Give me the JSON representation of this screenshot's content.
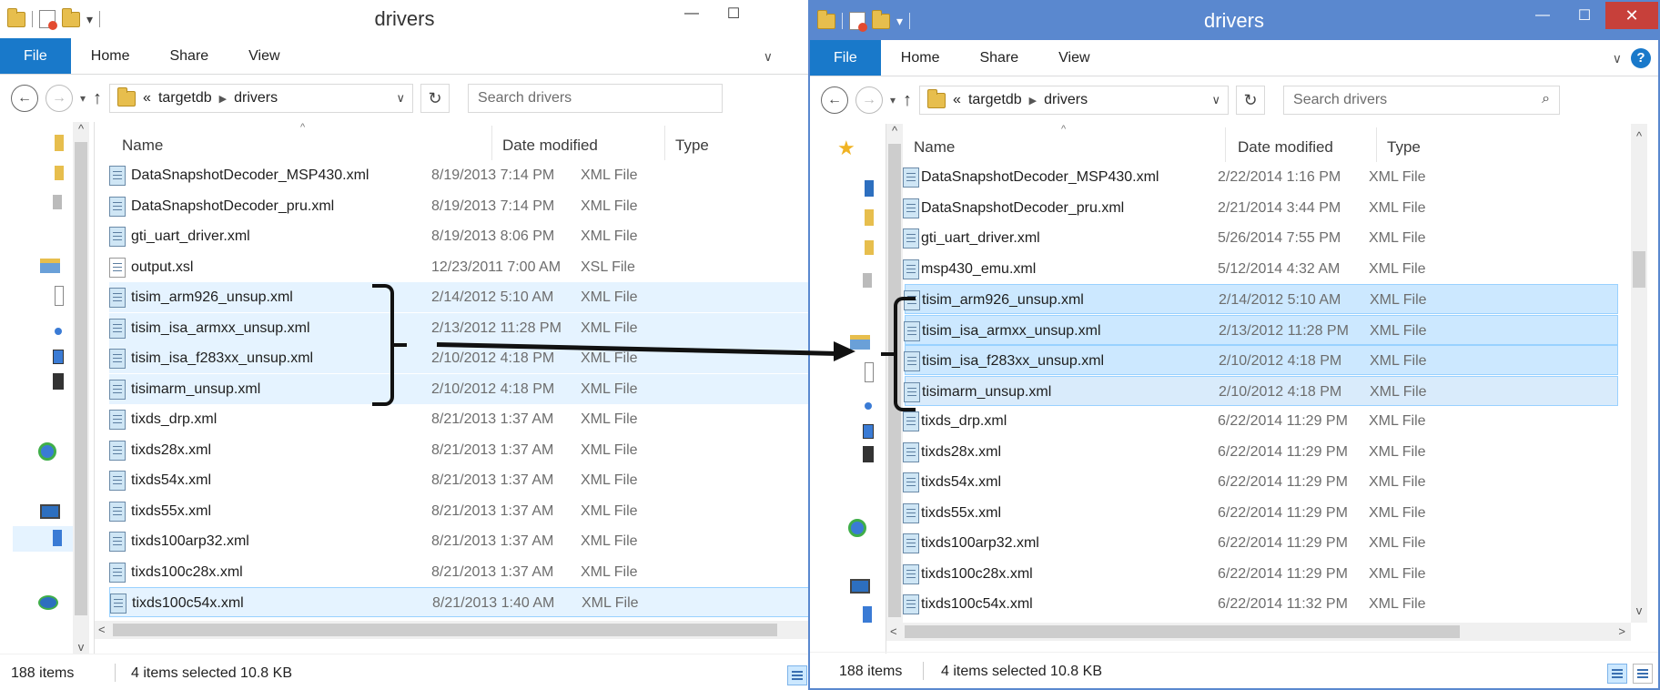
{
  "left_window": {
    "title": "drivers",
    "ribbon_tabs": [
      "File",
      "Home",
      "Share",
      "View"
    ],
    "breadcrumb": {
      "overflow": "«",
      "items": [
        "targetdb",
        "drivers"
      ]
    },
    "search_placeholder": "Search drivers",
    "columns": {
      "name": "Name",
      "date": "Date modified",
      "type": "Type"
    },
    "files": [
      {
        "name": "DataSnapshotDecoder_MSP430.xml",
        "date": "8/19/2013 7:14 PM",
        "type": "XML File"
      },
      {
        "name": "DataSnapshotDecoder_pru.xml",
        "date": "8/19/2013 7:14 PM",
        "type": "XML File"
      },
      {
        "name": "gti_uart_driver.xml",
        "date": "8/19/2013 8:06 PM",
        "type": "XML File"
      },
      {
        "name": "output.xsl",
        "date": "12/23/2011 7:00 AM",
        "type": "XSL File"
      },
      {
        "name": "tisim_arm926_unsup.xml",
        "date": "2/14/2012 5:10 AM",
        "type": "XML File"
      },
      {
        "name": "tisim_isa_armxx_unsup.xml",
        "date": "2/13/2012 11:28 PM",
        "type": "XML File"
      },
      {
        "name": "tisim_isa_f283xx_unsup.xml",
        "date": "2/10/2012 4:18 PM",
        "type": "XML File"
      },
      {
        "name": "tisimarm_unsup.xml",
        "date": "2/10/2012 4:18 PM",
        "type": "XML File"
      },
      {
        "name": "tixds_drp.xml",
        "date": "8/21/2013 1:37 AM",
        "type": "XML File"
      },
      {
        "name": "tixds28x.xml",
        "date": "8/21/2013 1:37 AM",
        "type": "XML File"
      },
      {
        "name": "tixds54x.xml",
        "date": "8/21/2013 1:37 AM",
        "type": "XML File"
      },
      {
        "name": "tixds55x.xml",
        "date": "8/21/2013 1:37 AM",
        "type": "XML File"
      },
      {
        "name": "tixds100arp32.xml",
        "date": "8/21/2013 1:37 AM",
        "type": "XML File"
      },
      {
        "name": "tixds100c28x.xml",
        "date": "8/21/2013 1:37 AM",
        "type": "XML File"
      },
      {
        "name": "tixds100c54x.xml",
        "date": "8/21/2013 1:40 AM",
        "type": "XML File"
      }
    ],
    "status": {
      "items": "188 items",
      "selected": "4 items selected  10.8 KB"
    }
  },
  "right_window": {
    "title": "drivers",
    "ribbon_tabs": [
      "File",
      "Home",
      "Share",
      "View"
    ],
    "breadcrumb": {
      "overflow": "«",
      "items": [
        "targetdb",
        "drivers"
      ]
    },
    "search_placeholder": "Search drivers",
    "columns": {
      "name": "Name",
      "date": "Date modified",
      "type": "Type"
    },
    "files": [
      {
        "name": "DataSnapshotDecoder_MSP430.xml",
        "date": "2/22/2014 1:16 PM",
        "type": "XML File"
      },
      {
        "name": "DataSnapshotDecoder_pru.xml",
        "date": "2/21/2014 3:44 PM",
        "type": "XML File"
      },
      {
        "name": "gti_uart_driver.xml",
        "date": "5/26/2014 7:55 PM",
        "type": "XML File"
      },
      {
        "name": "msp430_emu.xml",
        "date": "5/12/2014 4:32 AM",
        "type": "XML File"
      },
      {
        "name": "tisim_arm926_unsup.xml",
        "date": "2/14/2012 5:10 AM",
        "type": "XML File"
      },
      {
        "name": "tisim_isa_armxx_unsup.xml",
        "date": "2/13/2012 11:28 PM",
        "type": "XML File"
      },
      {
        "name": "tisim_isa_f283xx_unsup.xml",
        "date": "2/10/2012 4:18 PM",
        "type": "XML File"
      },
      {
        "name": "tisimarm_unsup.xml",
        "date": "2/10/2012 4:18 PM",
        "type": "XML File"
      },
      {
        "name": "tixds_drp.xml",
        "date": "6/22/2014 11:29 PM",
        "type": "XML File"
      },
      {
        "name": "tixds28x.xml",
        "date": "6/22/2014 11:29 PM",
        "type": "XML File"
      },
      {
        "name": "tixds54x.xml",
        "date": "6/22/2014 11:29 PM",
        "type": "XML File"
      },
      {
        "name": "tixds55x.xml",
        "date": "6/22/2014 11:29 PM",
        "type": "XML File"
      },
      {
        "name": "tixds100arp32.xml",
        "date": "6/22/2014 11:29 PM",
        "type": "XML File"
      },
      {
        "name": "tixds100c28x.xml",
        "date": "6/22/2014 11:29 PM",
        "type": "XML File"
      },
      {
        "name": "tixds100c54x.xml",
        "date": "6/22/2014 11:32 PM",
        "type": "XML File"
      }
    ],
    "status": {
      "items": "188 items",
      "selected": "4 items selected  10.8 KB"
    }
  },
  "colors": {
    "accent": "#1979ca",
    "active_title": "#5a88cf",
    "selection": "#cce8ff",
    "close": "#c7403a"
  },
  "icons": [
    "folder-icon",
    "properties-icon",
    "back-icon",
    "forward-icon",
    "up-icon",
    "refresh-icon",
    "search-icon",
    "xml-file-icon",
    "xsl-file-icon",
    "help-icon",
    "details-view-icon",
    "large-icons-view-icon"
  ]
}
